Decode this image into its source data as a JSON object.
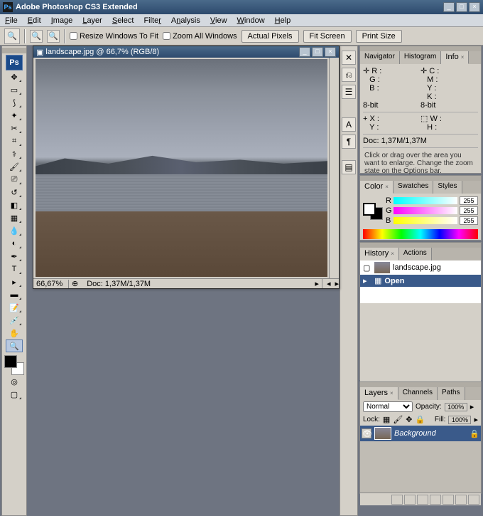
{
  "app": {
    "title": "Adobe Photoshop CS3 Extended"
  },
  "menu": [
    "File",
    "Edit",
    "Image",
    "Layer",
    "Select",
    "Filter",
    "Analysis",
    "View",
    "Window",
    "Help"
  ],
  "options": {
    "resize_label": "Resize Windows To Fit",
    "zoom_all_label": "Zoom All Windows",
    "actual_pixels": "Actual Pixels",
    "fit_screen": "Fit Screen",
    "print_size": "Print Size"
  },
  "doc": {
    "title": "landscape.jpg @ 66,7% (RGB/8)",
    "zoom": "66,67%",
    "size": "Doc: 1,37M/1,37M"
  },
  "info": {
    "tabs": [
      "Navigator",
      "Histogram",
      "Info"
    ],
    "r": "R :",
    "g": "G :",
    "b": "B :",
    "c": "C :",
    "m": "M :",
    "y": "Y :",
    "k": "K :",
    "bit": "8-bit",
    "x": "X :",
    "yy": "Y :",
    "w": "W :",
    "h": "H :",
    "docsize": "Doc: 1,37M/1,37M",
    "help": "Click or drag over the area you want to enlarge. Change the zoom state on the Options bar."
  },
  "color": {
    "tabs": [
      "Color",
      "Swatches",
      "Styles"
    ],
    "r": "R",
    "g": "G",
    "b": "B",
    "rv": "255",
    "gv": "255",
    "bv": "255"
  },
  "history": {
    "tabs": [
      "History",
      "Actions"
    ],
    "doc": "landscape.jpg",
    "step": "Open"
  },
  "layers": {
    "tabs": [
      "Layers",
      "Channels",
      "Paths"
    ],
    "blend": "Normal",
    "opacity_lbl": "Opacity:",
    "opacity": "100%",
    "lock_lbl": "Lock:",
    "fill_lbl": "Fill:",
    "fill": "100%",
    "bgname": "Background"
  }
}
